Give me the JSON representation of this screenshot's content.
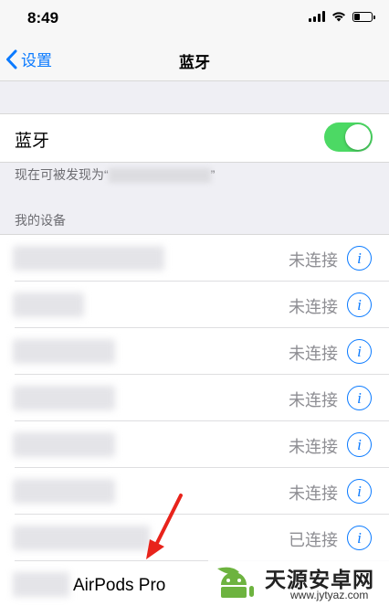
{
  "status_bar": {
    "time": "8:49",
    "battery_level": 0.35
  },
  "nav": {
    "back_label": "设置",
    "title": "蓝牙"
  },
  "bluetooth": {
    "label": "蓝牙",
    "enabled": true,
    "discoverable_text": "现在可被发现为“",
    "discoverable_suffix": "”"
  },
  "my_devices": {
    "header": "我的设备",
    "items": [
      {
        "status": "未连接"
      },
      {
        "status": "未连接"
      },
      {
        "status": "未连接"
      },
      {
        "status": "未连接"
      },
      {
        "status": "未连接"
      },
      {
        "status": "未连接"
      },
      {
        "status": "已连接"
      }
    ],
    "last_device_name": "AirPods Pro"
  },
  "watermark": {
    "title": "天源安卓网",
    "url": "www.jytyaz.com"
  },
  "colors": {
    "accent": "#0a7aff",
    "toggle_on": "#4cd964",
    "annotation_arrow": "#e8231b"
  },
  "icons": [
    "chevron-left-icon",
    "signal-icon",
    "wifi-icon",
    "battery-icon",
    "info-icon",
    "arrow-annotation"
  ]
}
